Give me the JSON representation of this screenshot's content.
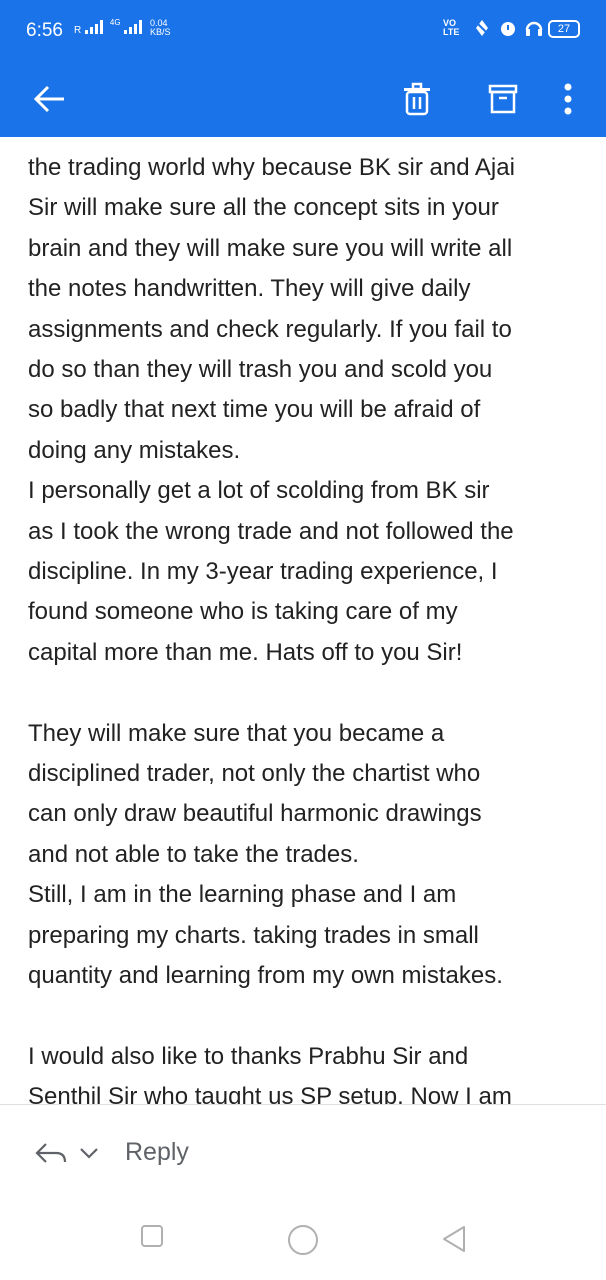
{
  "status_bar": {
    "time": "6:56",
    "signal_1": "R",
    "network_type": "4G",
    "data_speed_value": "0.04",
    "data_speed_unit": "KB/S",
    "volte_1": "VO",
    "volte_2": "LTE",
    "battery": "27"
  },
  "app_bar": {
    "back_icon": "arrow-left-icon",
    "delete_icon": "trash-icon",
    "archive_icon": "archive-icon",
    "more_icon": "more-vert-icon"
  },
  "message": {
    "lines": [
      "the trading world why because BK sir and Ajai",
      "Sir will make sure all the concept sits in your",
      "brain and they will make sure you will write all",
      "the notes handwritten. They will give daily",
      "assignments and check regularly. If you fail to",
      "do so than they will trash you and scold you",
      "so badly that next time you will be afraid of",
      "doing any mistakes.",
      "I personally get a lot of scolding from BK sir",
      "as I took the wrong trade and not followed the",
      "discipline. In my 3-year trading experience, I",
      "found someone who is taking care of my",
      "capital more than me. Hats off to you Sir!",
      "",
      "They will make sure that you became a",
      "disciplined trader, not only the chartist who",
      "can only draw beautiful harmonic drawings",
      "and not able to take the trades.",
      "Still, I am in the learning phase and I am",
      "preparing my charts. taking trades in small",
      "quantity and learning from my own mistakes.",
      "",
      "I would also like to thanks Prabhu Sir and",
      "Senthil Sir who taught us SP setup. Now I am"
    ]
  },
  "reply_bar": {
    "reply_label": "Reply"
  },
  "colors": {
    "app_bar": "#1a73e8",
    "text": "#222222",
    "reply_text": "#5f6368"
  }
}
